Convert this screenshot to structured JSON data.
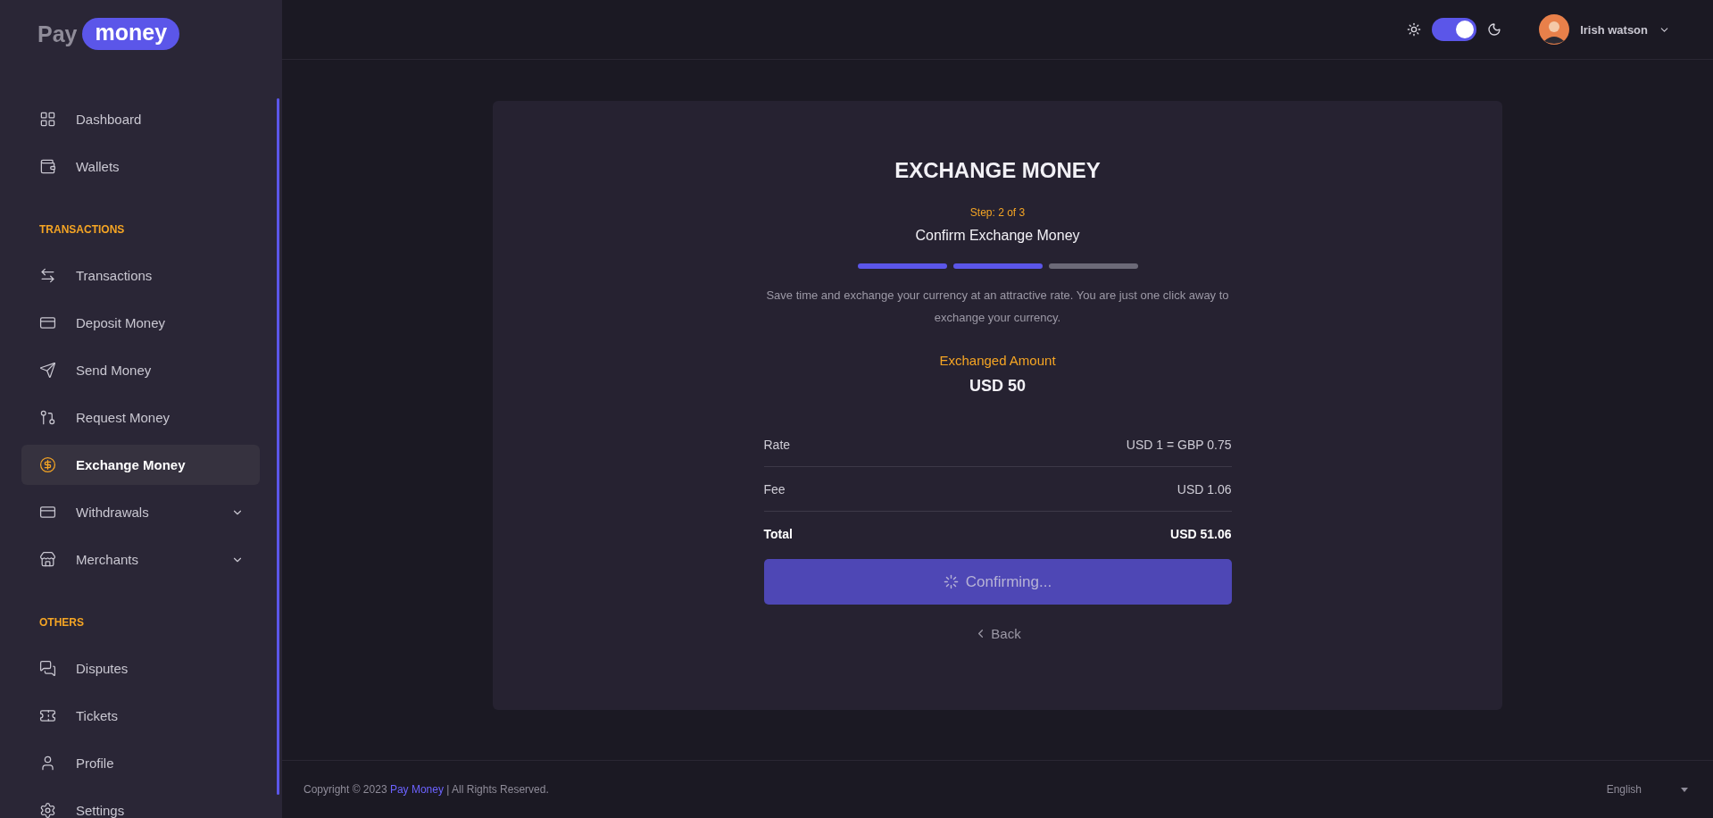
{
  "logo": {
    "first": "Pay",
    "second": "money"
  },
  "sidebar": {
    "sections": [
      {
        "items": [
          {
            "label": "Dashboard",
            "selected": false
          },
          {
            "label": "Wallets",
            "selected": false
          }
        ]
      },
      {
        "heading": "TRANSACTIONS",
        "items": [
          {
            "label": "Transactions",
            "selected": false
          },
          {
            "label": "Deposit Money",
            "selected": false
          },
          {
            "label": "Send Money",
            "selected": false
          },
          {
            "label": "Request Money",
            "selected": false
          },
          {
            "label": "Exchange Money",
            "selected": true
          },
          {
            "label": "Withdrawals",
            "selected": false,
            "expandable": true
          },
          {
            "label": "Merchants",
            "selected": false,
            "expandable": true
          }
        ]
      },
      {
        "heading": "OTHERS",
        "items": [
          {
            "label": "Disputes",
            "selected": false
          },
          {
            "label": "Tickets",
            "selected": false
          },
          {
            "label": "Profile",
            "selected": false
          },
          {
            "label": "Settings",
            "selected": false
          }
        ]
      }
    ]
  },
  "header": {
    "theme_toggle": {
      "on": true
    },
    "user": {
      "name": "Irish watson"
    }
  },
  "card": {
    "title": "EXCHANGE MONEY",
    "step": "Step: 2 of 3",
    "subtitle": "Confirm Exchange Money",
    "progress": [
      {
        "done": true
      },
      {
        "done": true
      },
      {
        "done": false
      }
    ],
    "description": "Save time and exchange your currency at an attractive rate. You are just one click away to exchange your currency.",
    "amount_label": "Exchanged Amount",
    "amount": "USD 50",
    "rows": [
      {
        "label": "Rate",
        "value": "USD 1 = GBP 0.75",
        "bold": false
      },
      {
        "label": "Fee",
        "value": "USD 1.06",
        "bold": false
      },
      {
        "label": "Total",
        "value": "USD 51.06",
        "bold": true
      }
    ],
    "button": {
      "label": "Confirming...",
      "loading": true
    },
    "back": "Back"
  },
  "footer": {
    "copyright_before": "Copyright © 2023 ",
    "link": "Pay Money",
    "copyright_after": " | All Rights Reserved.",
    "language": "English"
  }
}
